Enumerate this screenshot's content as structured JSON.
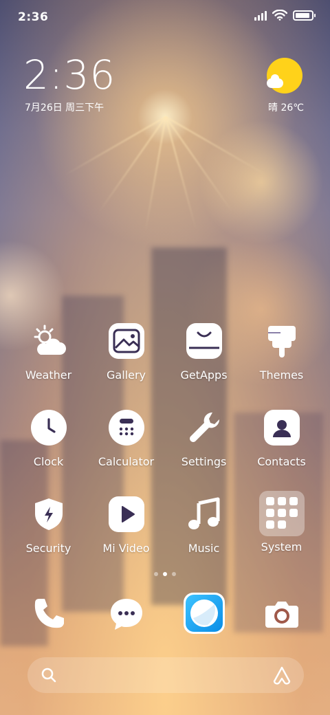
{
  "status_bar": {
    "time": "2:36",
    "battery_level": 0.9
  },
  "clock_widget": {
    "time": "2:36",
    "date": "7月26日 周三下午"
  },
  "weather_widget": {
    "text": "晴 26℃",
    "icon": "sun-cloud-icon"
  },
  "apps": [
    {
      "label": "Weather",
      "icon": "weather-icon"
    },
    {
      "label": "Gallery",
      "icon": "gallery-icon"
    },
    {
      "label": "GetApps",
      "icon": "getapps-icon"
    },
    {
      "label": "Themes",
      "icon": "themes-icon"
    },
    {
      "label": "Clock",
      "icon": "clock-icon"
    },
    {
      "label": "Calculator",
      "icon": "calculator-icon"
    },
    {
      "label": "Settings",
      "icon": "settings-icon"
    },
    {
      "label": "Contacts",
      "icon": "contacts-icon"
    },
    {
      "label": "Security",
      "icon": "security-icon"
    },
    {
      "label": "Mi Video",
      "icon": "mi-video-icon"
    },
    {
      "label": "Music",
      "icon": "music-icon"
    },
    {
      "label": "System",
      "icon": "system-folder-icon"
    }
  ],
  "page_indicator": {
    "pages": 3,
    "current": 2
  },
  "dock": [
    {
      "icon": "phone-icon"
    },
    {
      "icon": "messages-icon"
    },
    {
      "icon": "browser-icon"
    },
    {
      "icon": "camera-icon"
    }
  ],
  "search_bar": {
    "left_icon": "search-icon",
    "right_icon": "assistant-icon"
  },
  "colors": {
    "sun": "#ffd21a",
    "browser_blue": "#1aa3ff"
  }
}
